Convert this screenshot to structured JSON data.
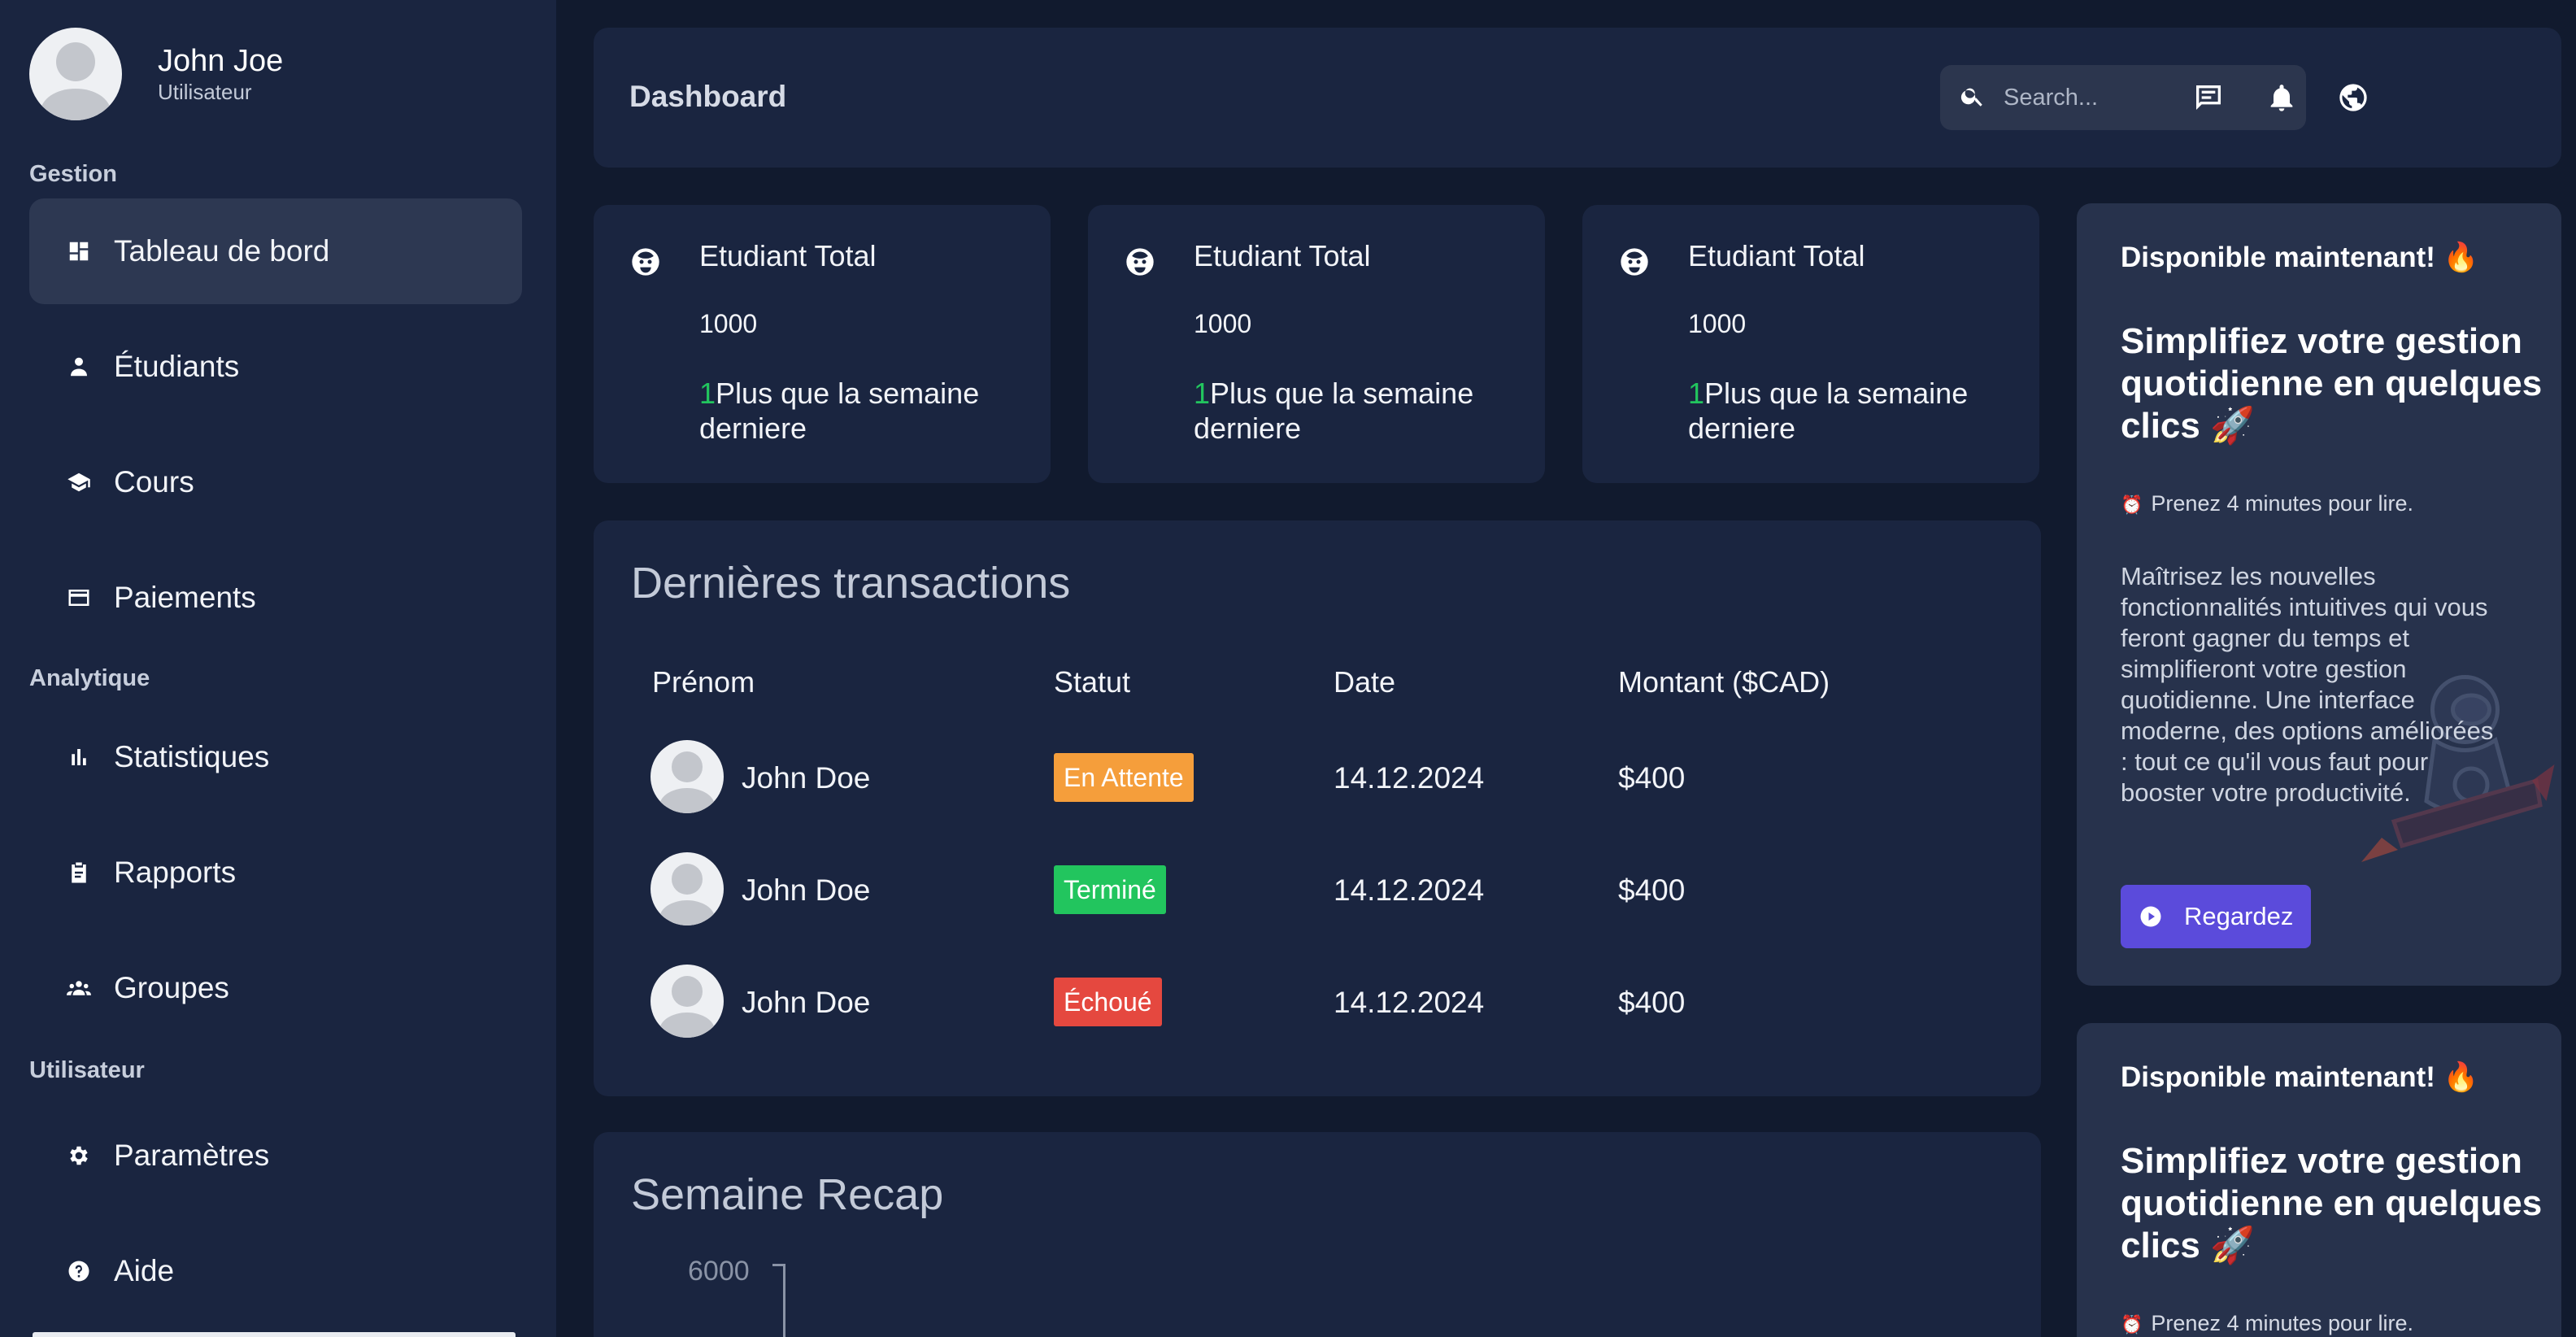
{
  "user": {
    "name": "John Joe",
    "role": "Utilisateur"
  },
  "sidebar": {
    "sections": [
      {
        "title": "Gestion"
      },
      {
        "title": "Analytique"
      },
      {
        "title": "Utilisateur"
      }
    ],
    "items": [
      {
        "label": "Tableau de bord",
        "icon": "dashboard-icon",
        "active": true
      },
      {
        "label": "Étudiants",
        "icon": "person-icon"
      },
      {
        "label": "Cours",
        "icon": "graduation-cap-icon"
      },
      {
        "label": "Paiements",
        "icon": "credit-card-icon"
      },
      {
        "label": "Statistiques",
        "icon": "bar-chart-icon"
      },
      {
        "label": "Rapports",
        "icon": "clipboard-icon"
      },
      {
        "label": "Groupes",
        "icon": "groups-icon"
      },
      {
        "label": "Paramètres",
        "icon": "gear-icon"
      },
      {
        "label": "Aide",
        "icon": "help-icon"
      }
    ]
  },
  "header": {
    "title": "Dashboard",
    "search_placeholder": "Search...",
    "icons": [
      "chat-icon",
      "bell-icon",
      "globe-icon"
    ]
  },
  "stats": [
    {
      "title": "Etudiant Total",
      "value": "1000",
      "delta": "1",
      "note": "Plus que la semaine derniere",
      "icon": "face-icon"
    },
    {
      "title": "Etudiant Total",
      "value": "1000",
      "delta": "1",
      "note": "Plus que la semaine derniere",
      "icon": "face-icon"
    },
    {
      "title": "Etudiant Total",
      "value": "1000",
      "delta": "1",
      "note": "Plus que la semaine derniere",
      "icon": "face-icon"
    }
  ],
  "transactions": {
    "title": "Dernières transactions",
    "columns": [
      "Prénom",
      "Statut",
      "Date",
      "Montant ($CAD)"
    ],
    "rows": [
      {
        "name": "John Doe",
        "status": "En Attente",
        "status_color": "#f59e3b",
        "date": "14.12.2024",
        "amount": "$400"
      },
      {
        "name": "John Doe",
        "status": "Terminé",
        "status_color": "#22c55e",
        "date": "14.12.2024",
        "amount": "$400"
      },
      {
        "name": "John Doe",
        "status": "Échoué",
        "status_color": "#e5483f",
        "date": "14.12.2024",
        "amount": "$400"
      }
    ]
  },
  "recap": {
    "title": "Semaine Recap",
    "y_max_label": "6000"
  },
  "promo": [
    {
      "available": "Disponible maintenant! 🔥",
      "heading": "Simplifiez votre gestion quotidienne en quelques clics 🚀",
      "read_time": "Prenez 4 minutes pour lire.",
      "body": "Maîtrisez les nouvelles fonctionnalités intuitives qui vous feront gagner du temps et simplifieront votre gestion quotidienne. Une interface moderne, des options améliorées : tout ce qu'il vous faut pour booster votre productivité.",
      "button": "Regardez"
    },
    {
      "available": "Disponible maintenant! 🔥",
      "heading": "Simplifiez votre gestion quotidienne en quelques clics 🚀",
      "read_time": "Prenez 4 minutes pour lire."
    }
  ],
  "colors": {
    "background": "#111a2e",
    "panel": "#1a2540",
    "promo_panel": "#27324c",
    "active_nav": "#2d3852",
    "accent": "#5b4bdb",
    "positive": "#22c55e"
  }
}
